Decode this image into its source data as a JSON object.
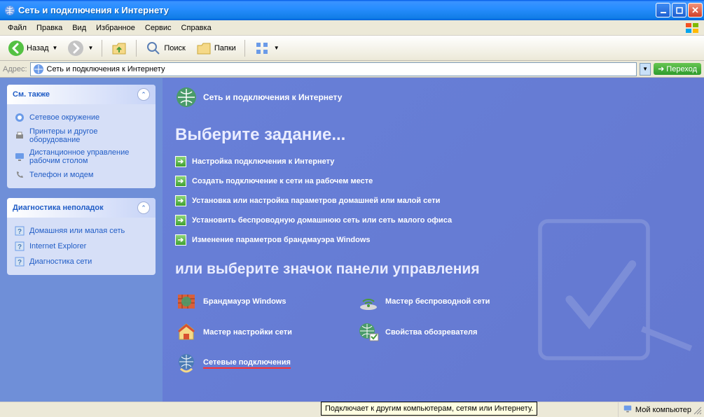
{
  "titlebar": {
    "title": "Сеть и подключения к Интернету"
  },
  "menu": {
    "items": [
      "Файл",
      "Правка",
      "Вид",
      "Избранное",
      "Сервис",
      "Справка"
    ]
  },
  "toolbar": {
    "back": "Назад",
    "search": "Поиск",
    "folders": "Папки"
  },
  "addressbar": {
    "label": "Адрес:",
    "value": "Сеть и подключения к Интернету",
    "go": "Переход"
  },
  "sidebar": {
    "panels": [
      {
        "title": "См. также",
        "links": [
          "Сетевое окружение",
          "Принтеры и другое оборудование",
          "Дистанционное управление рабочим столом",
          "Телефон и модем"
        ]
      },
      {
        "title": "Диагностика неполадок",
        "links": [
          "Домашняя или малая сеть",
          "Internet Explorer",
          "Диагностика сети"
        ]
      }
    ]
  },
  "main": {
    "header": "Сеть и подключения к Интернету",
    "heading1": "Выберите задание...",
    "tasks": [
      "Настройка подключения к Интернету",
      "Создать подключение к сети на рабочем месте",
      "Установка или настройка параметров домашней или малой сети",
      "Установить беспроводную домашнюю сеть или сеть малого офиса",
      "Изменение параметров брандмауэра Windows"
    ],
    "heading2": "или выберите значок панели управления",
    "cp_items": [
      "Брандмауэр Windows",
      "Мастер беспроводной сети",
      "Мастер настройки сети",
      "Свойства обозревателя",
      "Сетевые подключения"
    ]
  },
  "statusbar": {
    "tooltip": "Подключает к другим компьютерам, сетям или Интернету.",
    "location": "Мой компьютер"
  }
}
